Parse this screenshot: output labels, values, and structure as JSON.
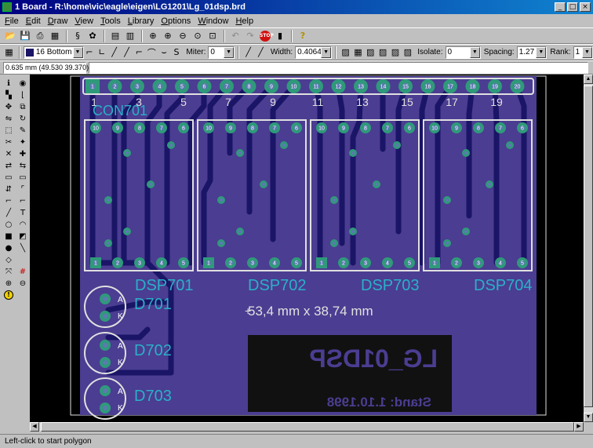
{
  "window": {
    "title": "1 Board - R:\\home\\vic\\eagle\\eigen\\LG1201\\Lg_01dsp.brd",
    "buttons": [
      "_",
      "□",
      "×"
    ]
  },
  "menu": [
    "File",
    "Edit",
    "Draw",
    "View",
    "Tools",
    "Library",
    "Options",
    "Window",
    "Help"
  ],
  "toolbar2": {
    "layer": "16 Bottom",
    "miter_label": "Miter:",
    "miter_value": "0",
    "width_label": "Width:",
    "width_value": "0.4064",
    "isolate_label": "Isolate:",
    "isolate_value": "0",
    "spacing_label": "Spacing:",
    "spacing_value": "1.27",
    "rank_label": "Rank:",
    "rank_value": "1"
  },
  "coords": "0.635 mm (49.530 39.370)",
  "board": {
    "connector_label": "CON701",
    "pin_numbers_top": [
      "1",
      "2",
      "3",
      "4",
      "5",
      "6",
      "7",
      "8",
      "9",
      "10",
      "11",
      "12",
      "13",
      "14",
      "15",
      "16",
      "17",
      "18",
      "19",
      "20"
    ],
    "pin_numbers_below": [
      "1",
      "3",
      "5",
      "7",
      "9",
      "11",
      "13",
      "15",
      "17",
      "19"
    ],
    "displays": [
      {
        "label": "DSP701",
        "top_pins": [
          "10",
          "9",
          "8",
          "7",
          "6"
        ],
        "bottom_pins": [
          "1",
          "2",
          "3",
          "4",
          "5"
        ]
      },
      {
        "label": "DSP702",
        "top_pins": [
          "10",
          "9",
          "8",
          "7",
          "6"
        ],
        "bottom_pins": [
          "1",
          "2",
          "3",
          "4",
          "5"
        ]
      },
      {
        "label": "DSP703",
        "top_pins": [
          "10",
          "9",
          "8",
          "7",
          "6"
        ],
        "bottom_pins": [
          "1",
          "2",
          "3",
          "4",
          "5"
        ]
      },
      {
        "label": "DSP704",
        "top_pins": [
          "10",
          "9",
          "8",
          "7",
          "6"
        ],
        "bottom_pins": [
          "1",
          "2",
          "3",
          "4",
          "5"
        ]
      }
    ],
    "diodes": [
      {
        "label": "D701",
        "anode": "A",
        "cathode": "K"
      },
      {
        "label": "D702",
        "anode": "A",
        "cathode": "K"
      },
      {
        "label": "D703",
        "anode": "A",
        "cathode": "K"
      }
    ],
    "dimension_text": "53,4 mm x 38,74 mm",
    "mirrored_name": "LG_01DSP",
    "mirrored_date": "Stand: 1.10.1998"
  },
  "status": "Left-click to start polygon",
  "colors": {
    "board": "#4b3d91",
    "trace": "#1a1566",
    "pad": "#2f9a7a",
    "text": "#2ab0c8",
    "outline": "#e0e0e0",
    "dark_text_block": "#111111"
  }
}
